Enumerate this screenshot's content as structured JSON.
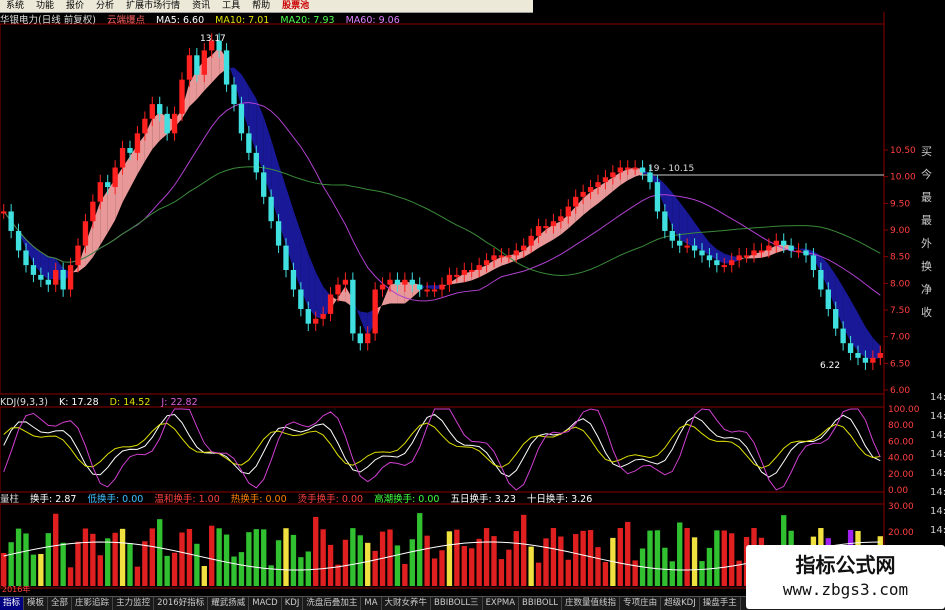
{
  "menu": [
    "系统",
    "功能",
    "报价",
    "分析",
    "扩展市场行情",
    "资讯",
    "工具",
    "帮助",
    "股票池"
  ],
  "price_header": {
    "stock": "华银电力(日线 前复权)",
    "indicator": "云端爆点",
    "ma5": "MA5: 6.60",
    "ma10": "MA10: 7.01",
    "ma20": "MA20: 7.93",
    "ma60": "MA60: 9.06"
  },
  "kdj_header": {
    "name": "KDJ(9,3,3)",
    "k": "K: 17.28",
    "d": "D: 14.52",
    "j": "J: 22.82"
  },
  "vol_header": {
    "name": "量柱",
    "hs": "换手: 2.87",
    "dhs": "低换手: 0.00",
    "whs": "温和换手: 1.00",
    "rhs": "热换手: 0.00",
    "thhs": "烫手换手: 0.00",
    "gchs": "高潮换手: 0.00",
    "wr": "五日换手: 3.23",
    "sr": "十日换手: 3.26"
  },
  "annotations": {
    "high": "13.17",
    "low": "6.22",
    "range": "19 - 10.15",
    "year": "2016年"
  },
  "price_axis": [
    "10.50",
    "10.00",
    "9.50",
    "9.00",
    "8.50",
    "8.00",
    "7.50",
    "7.00",
    "6.50",
    "6.00"
  ],
  "kdj_axis": [
    "100.00",
    "80.00",
    "60.00",
    "40.00",
    "20.00",
    "0.00"
  ],
  "vol_axis": [
    "30.00",
    "20.00",
    "10.00"
  ],
  "right_panel": [
    "买",
    "今",
    "最",
    "最",
    "外",
    "换",
    "净",
    "收"
  ],
  "right_times": [
    "14:",
    "14:",
    "14:",
    "14:",
    "14:",
    "14:",
    "14:",
    "14:",
    "14:",
    "14:"
  ],
  "tabs": [
    "指标",
    "模板",
    "全部",
    "庄影追踪",
    "主力监控",
    "2016好指标",
    "耀武扬威",
    "MACD",
    "KDJ",
    "洗盘后叠加主",
    "MA",
    "大财女养牛",
    "BBIBOLL三",
    "EXPMA",
    "BBIBOLL",
    "庄数量值线指",
    "专项庄由",
    "超级KDJ",
    "操盘手主"
  ],
  "watermark": {
    "line1": "指标公式网",
    "line2": "www.zbgs3.com"
  },
  "chart_data": {
    "type": "candlestick",
    "price_range": [
      5.9,
      10.8
    ],
    "close": [
      9.6,
      9.2,
      8.8,
      8.5,
      8.3,
      8.2,
      8.1,
      8.4,
      8.0,
      8.5,
      8.9,
      9.4,
      9.8,
      10.2,
      10.1,
      10.5,
      10.9,
      10.8,
      11.2,
      11.5,
      11.8,
      11.6,
      11.2,
      11.6,
      12.3,
      12.8,
      12.4,
      12.9,
      13.1,
      12.9,
      12.2,
      11.8,
      11.2,
      10.8,
      10.4,
      9.9,
      9.4,
      8.9,
      8.4,
      8.0,
      7.6,
      7.3,
      7.4,
      7.5,
      7.9,
      8.1,
      8.2,
      7.1,
      6.9,
      7.1,
      8.0,
      8.1,
      8.2,
      8.1,
      8.2,
      8.1,
      8.0,
      8.0,
      8.0,
      8.1,
      8.3,
      8.3,
      8.4,
      8.4,
      8.5,
      8.6,
      8.7,
      8.7,
      8.7,
      8.8,
      8.9,
      9.1,
      9.3,
      9.3,
      9.4,
      9.5,
      9.7,
      9.9,
      10.0,
      10.1,
      10.2,
      10.3,
      10.4,
      10.5,
      10.5,
      10.5,
      10.4,
      10.2,
      9.6,
      9.2,
      9.0,
      8.9,
      8.9,
      8.8,
      8.7,
      8.6,
      8.5,
      8.5,
      8.6,
      8.7,
      8.7,
      8.8,
      8.8,
      8.9,
      9.0,
      8.9,
      8.8,
      8.8,
      8.7,
      8.4,
      8.0,
      7.6,
      7.2,
      6.9,
      6.7,
      6.6,
      6.5,
      6.6,
      6.7
    ]
  }
}
